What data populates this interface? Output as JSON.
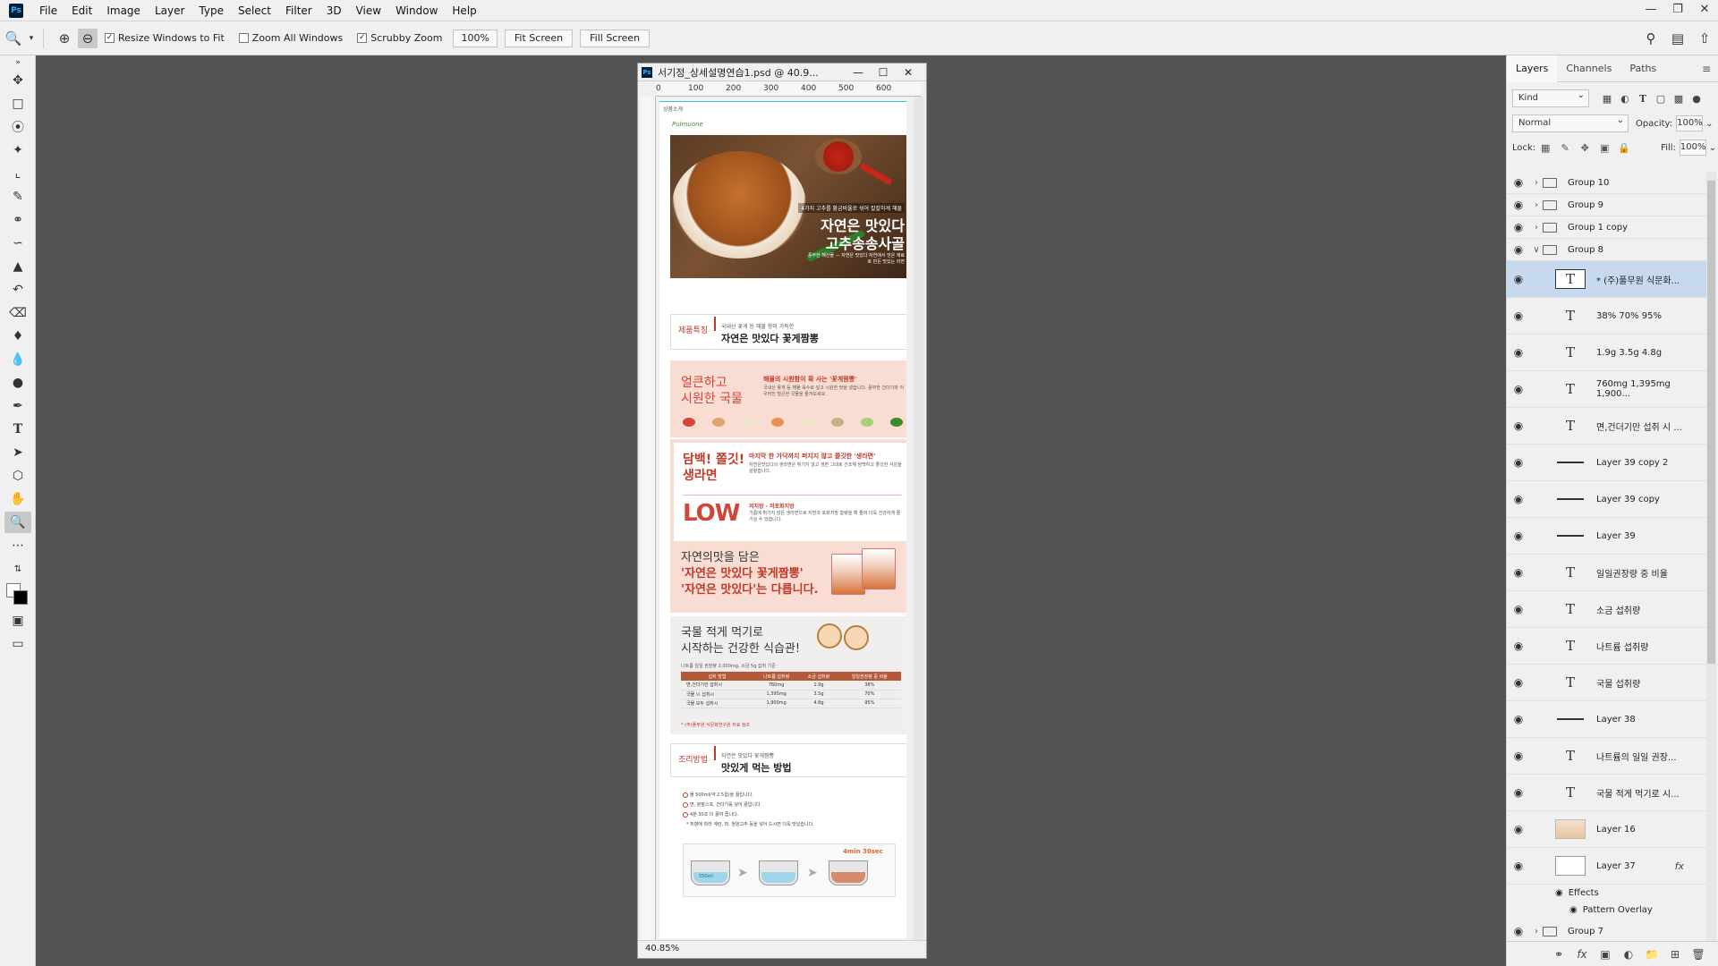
{
  "app": {
    "logo": "Ps"
  },
  "menu": [
    "File",
    "Edit",
    "Image",
    "Layer",
    "Type",
    "Select",
    "Filter",
    "3D",
    "View",
    "Window",
    "Help"
  ],
  "window_controls": [
    "—",
    "❐",
    "✕"
  ],
  "options": {
    "resize_windows": "Resize Windows to Fit",
    "zoom_all": "Zoom All Windows",
    "scrubby_zoom": "Scrubby Zoom",
    "zoom_value": "100%",
    "fit_screen": "Fit Screen",
    "fill_screen": "Fill Screen",
    "resize_checked": true,
    "zoom_all_checked": false,
    "scrubby_checked": true
  },
  "document": {
    "title": "서기정_상세설명연습1.psd @ 40.9...",
    "zoom_status": "40.85%",
    "ruler_ticks": [
      "0",
      "100",
      "200",
      "300",
      "400",
      "500",
      "600"
    ]
  },
  "canvas": {
    "brand_tag": "상품소개",
    "brand": "Pulmuone",
    "hero_sub": "4가지 고추를 황금비율로 섞어 칼칼하게 해물",
    "hero_title1": "자연은 맛있다",
    "hero_title2": "고추송송사골",
    "hero_small": "풍부한 해산물 — 자연은 맛있다 자연에서 얻은 재료로 만든 맛있는 라면",
    "feature_label": "제품특징",
    "feature_small": "국내산 꽃게 등 해물 향미 가득한",
    "feature_big": "자연은 맛있다 꽃게짬뽕",
    "pink1_head1": "얼큰하고",
    "pink1_head2": "시원한 국물",
    "pink1_sub": "해물의 시원함이 확 사는 '꽃게짬뽕'",
    "pink1_txt": "국내산 꽃게 등 해물 육수로 깊고 시원한 맛을 냈습니다. 풍부한 건더기와 어우러진 얼큰한 국물을 즐겨보세요.",
    "p2_head1": "담백! 쫄깃!",
    "p2_head2": "생라면",
    "p2_sub": "마지막 한 가닥까지 퍼지지 않고 쫄깃한 '생라면'",
    "p2_txt": "자연은맛있다의 생라면은 튀기지 않고 생면 그대로 건조해 담백하고 쫄깃한 식감을 살렸습니다.",
    "low": "LOW",
    "low_sub": "저지방 · 저포화지방",
    "low_txt": "기름에 튀기지 않은 생라면으로 지방과 포화지방 함량을 확 줄여 더욱 건강하게 즐기실 수 있습니다.",
    "p3_line1": "자연의맛을 담은",
    "p3_line2": "'자연은 맛있다 꽃게짬뽕'",
    "p3_line3": "'자연은 맛있다'는 다릅니다.",
    "gray_head1": "국물 적게 먹기로",
    "gray_head2": "시작하는 건강한 식습관!",
    "gray_note": "나트륨 일일 권장량 2,000mg, 소금 5g 섭취 기준",
    "table_headers": [
      "섭취 방법",
      "나트륨 섭취량",
      "소금 섭취량",
      "일일권장량 중 비율"
    ],
    "table_rows": [
      [
        "면,건더기만 섭취시",
        "760mg",
        "1.9g",
        "38%"
      ],
      [
        "국물 ½ 섭취시",
        "1,395mg",
        "3.5g",
        "70%"
      ],
      [
        "국물 모두 섭취시",
        "1,900mg",
        "4.8g",
        "95%"
      ]
    ],
    "gray_foot": "* (주)풀무원 식문화연구원 자료 참조",
    "cook_label": "조리방법",
    "cook_small": "자연은 맛있다 꽃게짬뽕",
    "cook_big": "맛있게 먹는 방법",
    "steps": [
      "물 500ml(약 2.5컵)을 끓입니다.",
      "면, 분말스프, 건더기를 넣어 끓입니다.",
      "4분 30초 더 끓여 줍니다."
    ],
    "step_note": "* 취향에 따라 계란, 파, 청양고추 등을 넣어 드시면 더욱 맛있습니다.",
    "water_label": "550ml",
    "time_label": "4min 30sec"
  },
  "panel": {
    "tabs": [
      "Layers",
      "Channels",
      "Paths"
    ],
    "kind": "Kind",
    "blend": "Normal",
    "opacity_label": "Opacity:",
    "opacity": "100%",
    "lock_label": "Lock:",
    "fill_label": "Fill:",
    "fill": "100%",
    "effects_label": "Effects",
    "pattern_overlay": "Pattern Overlay",
    "layers": [
      {
        "name": "Group 10",
        "type": "group"
      },
      {
        "name": "Group 9",
        "type": "group"
      },
      {
        "name": "Group 1 copy",
        "type": "group"
      },
      {
        "name": "Group 8",
        "type": "group-open"
      },
      {
        "name": "* (주)풀무원 식문화...",
        "type": "text",
        "selected": true
      },
      {
        "name": "38% 70% 95%",
        "type": "text"
      },
      {
        "name": "1.9g 3.5g 4.8g",
        "type": "text"
      },
      {
        "name": "760mg 1,395mg 1,900...",
        "type": "text"
      },
      {
        "name": "면,건더기만 섭취 시 ...",
        "type": "text"
      },
      {
        "name": "Layer 39 copy 2",
        "type": "line"
      },
      {
        "name": "Layer 39 copy",
        "type": "line"
      },
      {
        "name": "Layer 39",
        "type": "line"
      },
      {
        "name": "일일권장량 중 비율",
        "type": "text"
      },
      {
        "name": "소금 섭취량",
        "type": "text"
      },
      {
        "name": "나트륨 섭취량",
        "type": "text"
      },
      {
        "name": "국물 섭취량",
        "type": "text"
      },
      {
        "name": "Layer 38",
        "type": "line"
      },
      {
        "name": "나트륨의 일일 권장...",
        "type": "text"
      },
      {
        "name": "국물 적게 먹기로 시...",
        "type": "text"
      },
      {
        "name": "Layer 16",
        "type": "image"
      },
      {
        "name": "Layer 37",
        "type": "white"
      },
      {
        "name": "Group 7",
        "type": "group"
      }
    ]
  }
}
